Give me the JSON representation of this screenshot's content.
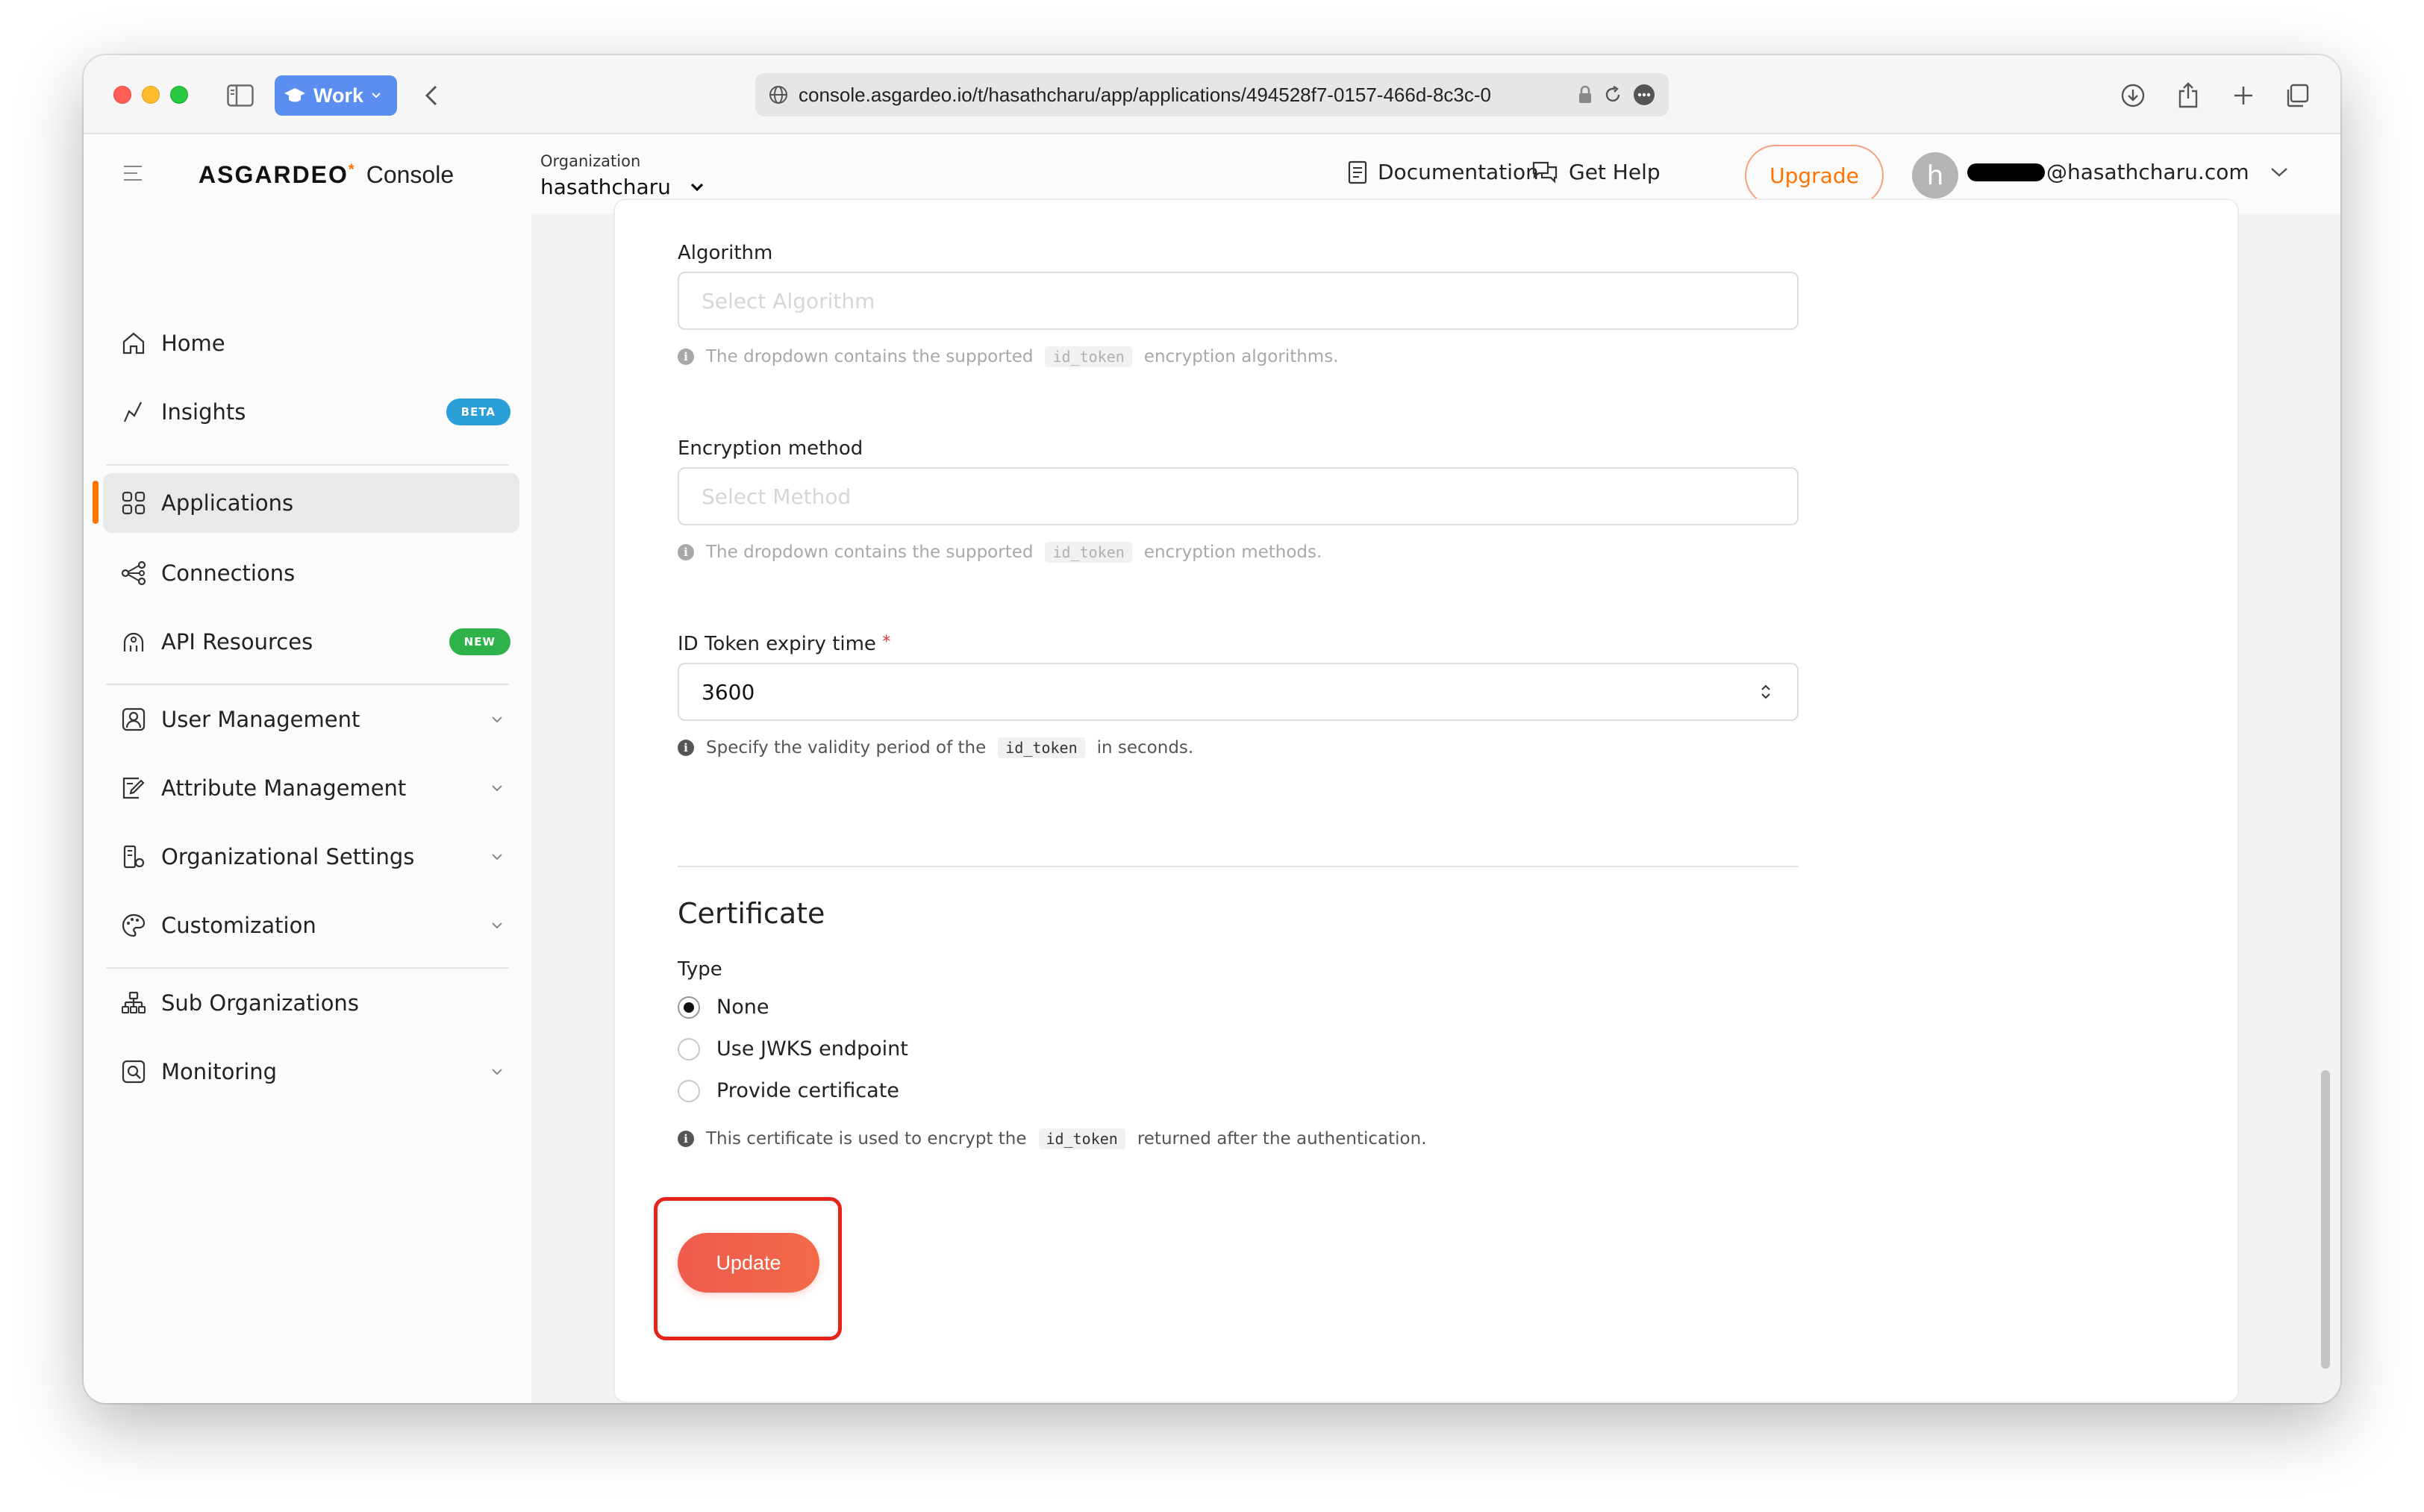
{
  "browser": {
    "profile_label": "Work",
    "url": "console.asgardeo.io/t/hasathcharu/app/applications/494528f7-0157-466d-8c3c-0"
  },
  "header": {
    "brand": "ASGARDEO",
    "brand_mark": "*",
    "product": "Console",
    "org_label": "Organization",
    "org_name": "hasathcharu",
    "documentation": "Documentation",
    "get_help": "Get Help",
    "upgrade": "Upgrade",
    "avatar_initial": "h",
    "user_email_visible": "@hasathcharu.com"
  },
  "sidebar": {
    "items": [
      {
        "label": "Home"
      },
      {
        "label": "Insights",
        "badge": "BETA"
      },
      {
        "label": "Applications",
        "active": true
      },
      {
        "label": "Connections"
      },
      {
        "label": "API Resources",
        "badge": "NEW"
      },
      {
        "label": "User Management"
      },
      {
        "label": "Attribute Management"
      },
      {
        "label": "Organizational Settings"
      },
      {
        "label": "Customization"
      },
      {
        "label": "Sub Organizations"
      },
      {
        "label": "Monitoring"
      }
    ]
  },
  "form": {
    "algorithm": {
      "label": "Algorithm",
      "placeholder": "Select Algorithm",
      "hint_prefix": "The dropdown contains the supported",
      "hint_code": "id_token",
      "hint_suffix": "encryption algorithms."
    },
    "encryption_method": {
      "label": "Encryption method",
      "placeholder": "Select Method",
      "hint_prefix": "The dropdown contains the supported",
      "hint_code": "id_token",
      "hint_suffix": "encryption methods."
    },
    "id_token_expiry": {
      "label": "ID Token expiry time",
      "required_mark": "*",
      "value": "3600",
      "hint_prefix": "Specify the validity period of the",
      "hint_code": "id_token",
      "hint_suffix": "in seconds."
    },
    "certificate": {
      "title": "Certificate",
      "type_label": "Type",
      "options": [
        {
          "label": "None",
          "checked": true
        },
        {
          "label": "Use JWKS endpoint",
          "checked": false
        },
        {
          "label": "Provide certificate",
          "checked": false
        }
      ],
      "hint_prefix": "This certificate is used to encrypt the",
      "hint_code": "id_token",
      "hint_suffix": "returned after the authentication."
    },
    "update_label": "Update"
  },
  "colors": {
    "accent": "#ff7300",
    "update_button": "#ee5a4c",
    "highlight": "#e5251b",
    "beta_badge": "#2a9fd8",
    "new_badge": "#2db34a"
  }
}
